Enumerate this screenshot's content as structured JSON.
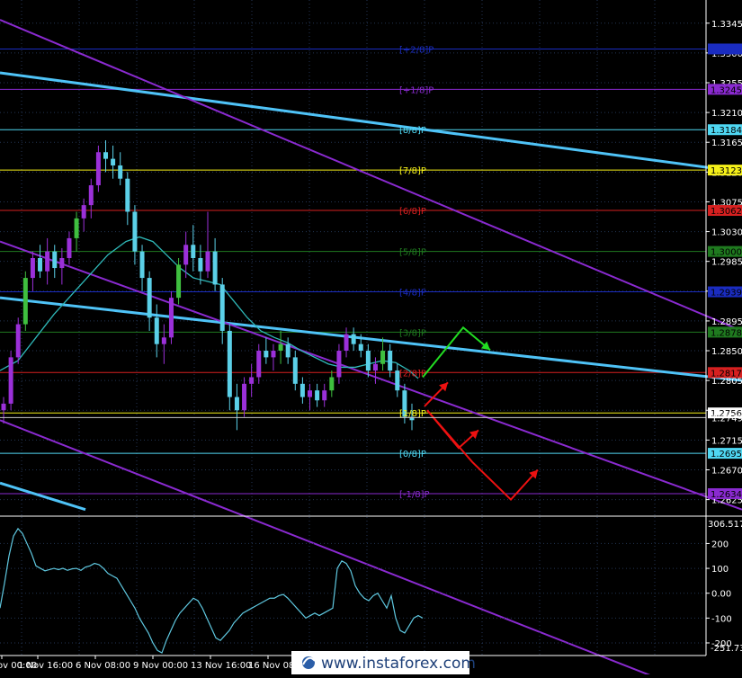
{
  "chart_data": [
    {
      "type": "candlestick",
      "title": "",
      "xlabel": "",
      "ylabel": "",
      "ylim": [
        1.26,
        1.338
      ],
      "x_ticks": [
        "1 Nov 00:00",
        "1 Nov 16:00",
        "6 Nov 08:00",
        "9 Nov 00:00",
        "13 Nov 16:00",
        "16 Nov 08:00",
        "21 Nov 08:00"
      ],
      "y_ticks": [
        1.3345,
        1.33,
        1.3255,
        1.321,
        1.3165,
        1.312,
        1.3075,
        1.303,
        1.2985,
        1.294,
        1.2895,
        1.285,
        1.2805,
        1.276,
        1.2715,
        1.267,
        1.2625
      ],
      "murrey_levels": [
        {
          "label": "[+2/8]P",
          "value": 1.3306,
          "color": "#1a2cc0",
          "text_color": "#1a2cc0"
        },
        {
          "label": "[+1/8]P",
          "value": 1.3245,
          "color": "#8a2ad0",
          "text_color": "#8a2ad0"
        },
        {
          "label": "[8/8]P",
          "value": 1.3184,
          "color": "#4fd7f2",
          "text_color": "#4fd7f2"
        },
        {
          "label": "[7/8]P",
          "value": 1.3123,
          "color": "#f5f019",
          "text_color": "#f5f019"
        },
        {
          "label": "[6/8]P",
          "value": 1.3062,
          "color": "#d62020",
          "text_color": "#d62020"
        },
        {
          "label": "[5/8]P",
          "value": 1.3,
          "color": "#1f7a1f",
          "text_color": "#1f7a1f"
        },
        {
          "label": "[4/8]P",
          "value": 1.2939,
          "color": "#1a2cc0",
          "text_color": "#1a2cc0"
        },
        {
          "label": "[3/8]P",
          "value": 1.2878,
          "color": "#1f7a1f",
          "text_color": "#1f7a1f"
        },
        {
          "label": "[2/8]P",
          "value": 1.2817,
          "color": "#d62020",
          "text_color": "#d62020"
        },
        {
          "label": "[1/8]P",
          "value": 1.2756,
          "color": "#f5f019",
          "text_color": "#f5f019"
        },
        {
          "label": "[0/8]P",
          "value": 1.2695,
          "color": "#4fd7f2",
          "text_color": "#4fd7f2"
        },
        {
          "label": "[-1/8]P",
          "value": 1.2634,
          "color": "#8a2ad0",
          "text_color": "#8a2ad0"
        }
      ],
      "price_tags": [
        {
          "value": 1.3306,
          "bg": "#1a2cc0",
          "fg": "#1a2cc0"
        },
        {
          "value": 1.3245,
          "bg": "#8a2ad0",
          "fg": "#000000"
        },
        {
          "value": 1.3184,
          "bg": "#4fd7f2",
          "fg": "#000000"
        },
        {
          "value": 1.3123,
          "bg": "#f5f019",
          "fg": "#000000"
        },
        {
          "value": 1.3062,
          "bg": "#d62020",
          "fg": "#000000"
        },
        {
          "value": 1.3,
          "bg": "#1f7a1f",
          "fg": "#000000"
        },
        {
          "value": 1.2939,
          "bg": "#1a2cc0",
          "fg": "#000000"
        },
        {
          "value": 1.2878,
          "bg": "#1f7a1f",
          "fg": "#000000"
        },
        {
          "value": 1.2817,
          "bg": "#d62020",
          "fg": "#000000"
        },
        {
          "value": 1.2756,
          "bg": "#ffffff",
          "fg": "#000000"
        },
        {
          "value": 1.2695,
          "bg": "#4fd7f2",
          "fg": "#000000"
        },
        {
          "value": 1.2634,
          "bg": "#8a2ad0",
          "fg": "#000000"
        }
      ],
      "current_price": 1.2749,
      "trend_lines": [
        {
          "color": "#4fc3f7",
          "width": 3,
          "points": [
            [
              0,
              1.327
            ],
            [
              825,
              1.312
            ]
          ]
        },
        {
          "color": "#4fc3f7",
          "width": 3,
          "points": [
            [
              0,
              1.293
            ],
            [
              825,
              1.2805
            ]
          ]
        },
        {
          "color": "#4fc3f7",
          "width": 3,
          "points": [
            [
              0,
              1.265
            ],
            [
              95,
              1.261
            ]
          ]
        },
        {
          "color": "#8a2ad0",
          "width": 2,
          "points": [
            [
              0,
              1.335
            ],
            [
              825,
              1.288
            ]
          ]
        },
        {
          "color": "#8a2ad0",
          "width": 2,
          "points": [
            [
              0,
              1.3015
            ],
            [
              825,
              1.261
            ]
          ]
        },
        {
          "color": "#8a2ad0",
          "width": 2,
          "points": [
            [
              0,
              1.2745
            ],
            [
              825,
              1.2305
            ]
          ]
        }
      ],
      "moving_average": {
        "color": "#2fb8b8",
        "points": [
          [
            0,
            1.282
          ],
          [
            20,
            1.2835
          ],
          [
            40,
            1.287
          ],
          [
            60,
            1.2905
          ],
          [
            80,
            1.2935
          ],
          [
            100,
            1.2965
          ],
          [
            120,
            1.2995
          ],
          [
            140,
            1.3015
          ],
          [
            155,
            1.3022
          ],
          [
            170,
            1.3015
          ],
          [
            185,
            1.2995
          ],
          [
            200,
            1.2975
          ],
          [
            215,
            1.296
          ],
          [
            230,
            1.2955
          ],
          [
            245,
            1.295
          ],
          [
            260,
            1.2925
          ],
          [
            275,
            1.29
          ],
          [
            290,
            1.288
          ],
          [
            305,
            1.287
          ],
          [
            320,
            1.2862
          ],
          [
            335,
            1.285
          ],
          [
            350,
            1.284
          ],
          [
            365,
            1.283
          ],
          [
            380,
            1.2825
          ],
          [
            395,
            1.2825
          ],
          [
            410,
            1.283
          ],
          [
            425,
            1.2835
          ],
          [
            440,
            1.2832
          ],
          [
            455,
            1.282
          ],
          [
            465,
            1.2808
          ]
        ]
      },
      "signal_arrows": [
        {
          "color": "#22dd22",
          "points": [
            [
              470,
              1.281
            ],
            [
              515,
              1.2885
            ],
            [
              545,
              1.2851
            ]
          ]
        },
        {
          "color": "#ee1111",
          "points": [
            [
              472,
              1.2766
            ],
            [
              498,
              1.2802
            ]
          ]
        },
        {
          "color": "#ee1111",
          "points": [
            [
              475,
              1.276
            ],
            [
              510,
              1.2703
            ],
            [
              532,
              1.273
            ]
          ]
        },
        {
          "color": "#ee1111",
          "points": [
            [
              475,
              1.276
            ],
            [
              525,
              1.2682
            ],
            [
              568,
              1.2625
            ],
            [
              598,
              1.267
            ]
          ]
        }
      ],
      "candles": [
        [
          1.276,
          1.278,
          1.274,
          1.277
        ],
        [
          1.277,
          1.285,
          1.276,
          1.284
        ],
        [
          1.284,
          1.29,
          1.283,
          1.289
        ],
        [
          1.289,
          1.297,
          1.288,
          1.296
        ],
        [
          1.296,
          1.3,
          1.294,
          1.299
        ],
        [
          1.299,
          1.301,
          1.296,
          1.297
        ],
        [
          1.297,
          1.302,
          1.295,
          1.3
        ],
        [
          1.3,
          1.301,
          1.296,
          1.2975
        ],
        [
          1.2975,
          1.3005,
          1.295,
          1.299
        ],
        [
          1.299,
          1.303,
          1.298,
          1.302
        ],
        [
          1.302,
          1.306,
          1.3,
          1.305
        ],
        [
          1.305,
          1.308,
          1.303,
          1.307
        ],
        [
          1.307,
          1.311,
          1.305,
          1.31
        ],
        [
          1.31,
          1.316,
          1.309,
          1.315
        ],
        [
          1.315,
          1.3168,
          1.312,
          1.314
        ],
        [
          1.314,
          1.316,
          1.311,
          1.313
        ],
        [
          1.313,
          1.315,
          1.31,
          1.311
        ],
        [
          1.311,
          1.312,
          1.304,
          1.306
        ],
        [
          1.306,
          1.307,
          1.298,
          1.3
        ],
        [
          1.3,
          1.301,
          1.294,
          1.296
        ],
        [
          1.296,
          1.297,
          1.288,
          1.29
        ],
        [
          1.29,
          1.292,
          1.284,
          1.286
        ],
        [
          1.286,
          1.289,
          1.283,
          1.287
        ],
        [
          1.287,
          1.294,
          1.286,
          1.293
        ],
        [
          1.293,
          1.299,
          1.292,
          1.298
        ],
        [
          1.298,
          1.303,
          1.296,
          1.301
        ],
        [
          1.301,
          1.304,
          1.297,
          1.299
        ],
        [
          1.299,
          1.301,
          1.295,
          1.297
        ],
        [
          1.297,
          1.306,
          1.296,
          1.3
        ],
        [
          1.3,
          1.302,
          1.294,
          1.295
        ],
        [
          1.295,
          1.296,
          1.286,
          1.288
        ],
        [
          1.288,
          1.289,
          1.276,
          1.278
        ],
        [
          1.278,
          1.28,
          1.273,
          1.276
        ],
        [
          1.276,
          1.281,
          1.275,
          1.28
        ],
        [
          1.28,
          1.283,
          1.278,
          1.281
        ],
        [
          1.281,
          1.286,
          1.28,
          1.285
        ],
        [
          1.285,
          1.287,
          1.283,
          1.284
        ],
        [
          1.284,
          1.286,
          1.282,
          1.285
        ],
        [
          1.285,
          1.288,
          1.283,
          1.286
        ],
        [
          1.286,
          1.287,
          1.283,
          1.284
        ],
        [
          1.284,
          1.285,
          1.279,
          1.28
        ],
        [
          1.28,
          1.281,
          1.277,
          1.278
        ],
        [
          1.278,
          1.28,
          1.276,
          1.279
        ],
        [
          1.279,
          1.28,
          1.2765,
          1.2775
        ],
        [
          1.2775,
          1.28,
          1.2765,
          1.279
        ],
        [
          1.279,
          1.282,
          1.278,
          1.281
        ],
        [
          1.281,
          1.286,
          1.28,
          1.285
        ],
        [
          1.285,
          1.2885,
          1.284,
          1.2875
        ],
        [
          1.2875,
          1.2885,
          1.285,
          1.286
        ],
        [
          1.286,
          1.2875,
          1.284,
          1.285
        ],
        [
          1.285,
          1.286,
          1.281,
          1.282
        ],
        [
          1.282,
          1.284,
          1.28,
          1.283
        ],
        [
          1.283,
          1.287,
          1.282,
          1.285
        ],
        [
          1.285,
          1.286,
          1.281,
          1.282
        ],
        [
          1.282,
          1.283,
          1.278,
          1.279
        ],
        [
          1.279,
          1.28,
          1.274,
          1.275
        ],
        [
          1.275,
          1.277,
          1.273,
          1.2745
        ]
      ]
    },
    {
      "type": "line",
      "title": "",
      "xlabel": "",
      "ylabel": "",
      "ylim": [
        -250.73,
        306.5172
      ],
      "max_label": "306.5172",
      "min_label": "-251.730",
      "y_ticks": [
        200,
        100,
        0,
        -100,
        -200
      ],
      "y_tick_labels": [
        "200",
        "100",
        "0.00",
        "-100",
        "-200"
      ],
      "series": [
        {
          "color": "#5fc8e0",
          "x": [
            0,
            5,
            10,
            15,
            20,
            25,
            30,
            35,
            40,
            45,
            50,
            55,
            60,
            65,
            70,
            75,
            80,
            85,
            90,
            95,
            100,
            105,
            110,
            115,
            120,
            125,
            130,
            135,
            140,
            145,
            150,
            155,
            160,
            165,
            170,
            175,
            180,
            185,
            190,
            195,
            200,
            205,
            210,
            215,
            220,
            225,
            230,
            235,
            240,
            245,
            250,
            255,
            260,
            265,
            270,
            275,
            280,
            285,
            290,
            295,
            300,
            305,
            310,
            315,
            320,
            325,
            330,
            335,
            340,
            345,
            350,
            355,
            360,
            365,
            370,
            375,
            380,
            385,
            390,
            395,
            400,
            405,
            410,
            415,
            420,
            425,
            430,
            435,
            440,
            445,
            450,
            455,
            460,
            465,
            470
          ],
          "values": [
            -60,
            40,
            150,
            230,
            260,
            240,
            200,
            160,
            110,
            100,
            90,
            95,
            100,
            95,
            100,
            92,
            98,
            100,
            92,
            105,
            110,
            120,
            115,
            100,
            80,
            70,
            60,
            30,
            0,
            -30,
            -60,
            -100,
            -130,
            -160,
            -200,
            -230,
            -240,
            -190,
            -150,
            -110,
            -80,
            -60,
            -40,
            -20,
            -30,
            -60,
            -100,
            -140,
            -180,
            -190,
            -170,
            -150,
            -120,
            -100,
            -80,
            -70,
            -60,
            -50,
            -40,
            -30,
            -20,
            -20,
            -10,
            -5,
            -20,
            -40,
            -60,
            -80,
            -100,
            -90,
            -80,
            -90,
            -80,
            -70,
            -60,
            100,
            130,
            120,
            90,
            30,
            0,
            -20,
            -30,
            -10,
            0,
            -30,
            -60,
            -10,
            -100,
            -150,
            -160,
            -130,
            -100,
            -90,
            -100
          ]
        }
      ]
    }
  ],
  "watermark": "www.instaforex.com",
  "colors": {
    "background": "#000000",
    "grid": "#233553",
    "axis_text": "#ffffff",
    "bull_candle": "#9b30d9",
    "bear_candle": "#5bd0e8",
    "bull_candle_alt": "#3fbf3f"
  }
}
